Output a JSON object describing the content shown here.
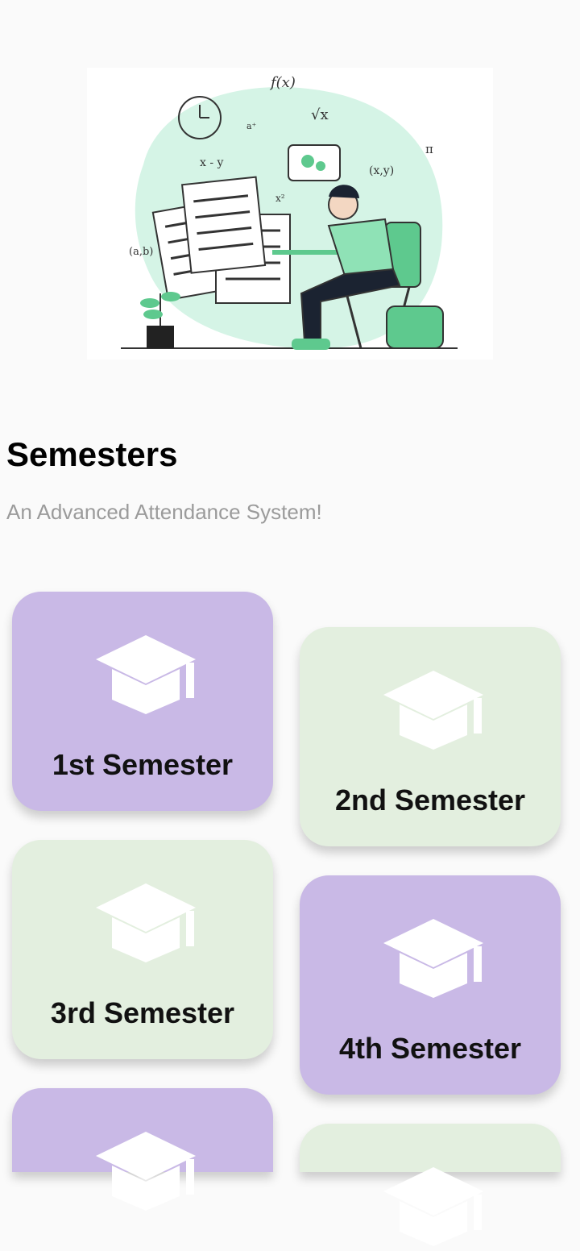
{
  "header": {
    "title": "Semesters",
    "subtitle": "An Advanced Attendance System!"
  },
  "illustration": {
    "math_labels": [
      "f(x)",
      "a⁺",
      "√x",
      "x - y",
      "x²",
      "(x,y)",
      "(a,b)",
      "π"
    ]
  },
  "colors": {
    "purple": "#c9b9e6",
    "green": "#e3efdf",
    "mint_blob": "#d5f4e6",
    "accent_green": "#5ec98e",
    "cap_icon": "#ffffff"
  },
  "semesters": [
    {
      "label": "1st Semester",
      "color": "purple",
      "icon": "graduation-cap-icon"
    },
    {
      "label": "2nd Semester",
      "color": "green",
      "icon": "graduation-cap-icon"
    },
    {
      "label": "3rd Semester",
      "color": "green",
      "icon": "graduation-cap-icon"
    },
    {
      "label": "4th Semester",
      "color": "purple",
      "icon": "graduation-cap-icon"
    },
    {
      "label": "",
      "color": "purple",
      "icon": "graduation-cap-icon"
    },
    {
      "label": "",
      "color": "green",
      "icon": "graduation-cap-icon"
    }
  ]
}
